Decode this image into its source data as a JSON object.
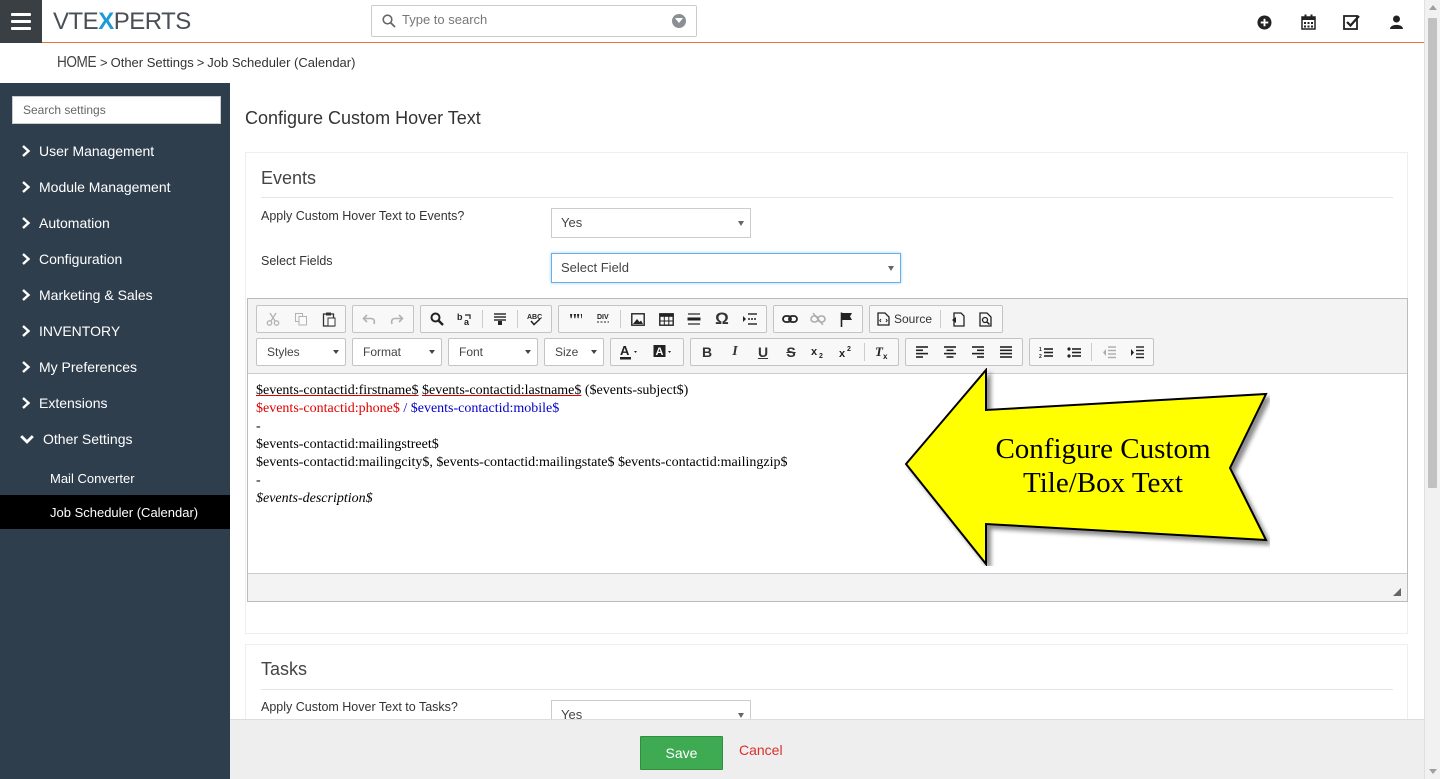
{
  "header": {
    "logo_part1": "VTE",
    "logo_part2": "X",
    "logo_part3": "PERTS",
    "search_placeholder": "Type to search",
    "icons": [
      "plus-circle-icon",
      "calendar-icon",
      "checkbox-icon",
      "user-icon"
    ]
  },
  "breadcrumb": {
    "home": "HOME",
    "sep1": ">",
    "item1": "Other Settings",
    "sep2": ">",
    "item2": "Job Scheduler (Calendar)"
  },
  "sidebar": {
    "search_placeholder": "Search settings",
    "items": [
      {
        "label": "User Management"
      },
      {
        "label": "Module Management"
      },
      {
        "label": "Automation"
      },
      {
        "label": "Configuration"
      },
      {
        "label": "Marketing & Sales"
      },
      {
        "label": "INVENTORY"
      },
      {
        "label": "My Preferences"
      },
      {
        "label": "Extensions"
      },
      {
        "label": "Other Settings"
      }
    ],
    "subitems": [
      {
        "label": "Mail Converter"
      },
      {
        "label": "Job Scheduler (Calendar)"
      }
    ]
  },
  "main": {
    "page_title": "Configure Custom Hover Text",
    "events": {
      "title": "Events",
      "apply_label": "Apply Custom Hover Text to Events?",
      "apply_value": "Yes",
      "fields_label": "Select Fields",
      "fields_value": "Select Field"
    },
    "editor": {
      "combos": {
        "styles": "Styles",
        "format": "Format",
        "font": "Font",
        "size": "Size"
      },
      "source_label": "Source",
      "content": {
        "line1_a": "$events-contactid:firstname$",
        "line1_b": "$events-contactid:lastname$",
        "line1_c": "($events-subject$)",
        "line2_a": "$events-contactid:phone$",
        "line2_sep": " / ",
        "line2_b": "$events-contactid:mobile$",
        "line3": "-",
        "line4": "$events-contactid:mailingstreet$",
        "line5": "$events-contactid:mailingcity$, $events-contactid:mailingstate$ $events-contactid:mailingzip$",
        "line6": "-",
        "line7": "$events-description$"
      }
    },
    "callout": {
      "line1": "Configure Custom",
      "line2": "Tile/Box Text",
      "fill": "#ffff00"
    },
    "tasks": {
      "title": "Tasks",
      "apply_label": "Apply Custom Hover Text to Tasks?",
      "apply_value": "Yes"
    }
  },
  "footer": {
    "save_label": "Save",
    "cancel_label": "Cancel"
  },
  "colors": {
    "sidebar_bg": "#2f3e4d",
    "accent_orange": "#e8703a",
    "save_green": "#3eaa52",
    "cancel_red": "#d9302c"
  }
}
